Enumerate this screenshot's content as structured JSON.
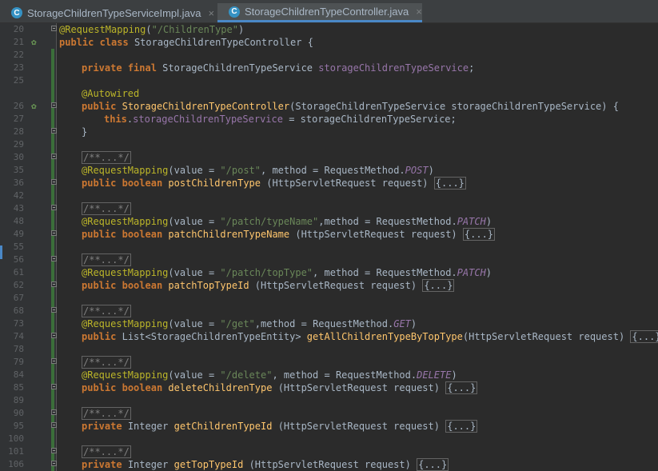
{
  "tabs": [
    {
      "label": "StorageChildrenTypeServiceImpl.java",
      "icon": "class-icon",
      "icon_letter": "C",
      "close": "×"
    },
    {
      "label": "StorageChildrenTypeController.java",
      "icon": "class-icon",
      "icon_letter": "C",
      "close": "×"
    }
  ],
  "colors": {
    "keyword": "#cc7832",
    "annotation": "#bbb529",
    "string": "#6a8759",
    "comment": "#808080",
    "field": "#9876aa",
    "method": "#ffc66d",
    "text": "#a9b7c6",
    "background": "#2b2b2b"
  },
  "code": {
    "ln": [
      "20",
      "21",
      "22",
      "23",
      "25",
      "26",
      "27",
      "28",
      "29",
      "30",
      "35",
      "36",
      "42",
      "43",
      "48",
      "49",
      "55",
      "56",
      "61",
      "62",
      "67",
      "68",
      "73",
      "74",
      "78",
      "79",
      "84",
      "85",
      "89",
      "90",
      "95",
      "100",
      "101",
      "106"
    ],
    "t": {
      "public": "public",
      "class": "class",
      "private": "private",
      "final": "final",
      "this": "this",
      "boolean": "boolean",
      "autowired": "@Autowired",
      "reqmap": "@RequestMapping",
      "open": "(",
      "close": ")",
      "value": "value",
      "eq": " = ",
      "comma": ",",
      "comma_sp": ", ",
      "method": "method",
      "reqmethod": "RequestMethod.",
      "javadoc": "/**...*/",
      "placeholder": "{...}",
      "brace_open": " {",
      "brace_close": "}",
      "semi": ";",
      "sp": " ",
      "path_children": "\"/ChildrenType\"",
      "path_post": "\"/post\"",
      "path_patch_name": "\"/patch/typeName\"",
      "path_patch_top": "\"/patch/topType\"",
      "path_get": "\"/get\"",
      "path_delete": "\"/delete\"",
      "post": "POST",
      "patch": "PATCH",
      "get": "GET",
      "delete": "DELETE",
      "controller": "StorageChildrenTypeController",
      "service_type": "StorageChildrenTypeService",
      "service_field": "storageChildrenTypeService",
      "service_param": "storageChildrenTypeService",
      "dot": ".",
      "post_fn": "postChildrenType",
      "patch_name_fn": "patchChildrenTypeName",
      "patch_top_fn": "patchTopTypeId",
      "get_fn": "getAllChildrenTypeByTopType",
      "delete_fn": "deleteChildrenType",
      "get_children_id_fn": "getChildrenTypeId",
      "get_top_id_fn": "getTopTypeId",
      "req_param": "(HttpServletRequest request)",
      "list_type": "List<StorageChildrenTypeEntity>",
      "integer": "Integer"
    }
  }
}
